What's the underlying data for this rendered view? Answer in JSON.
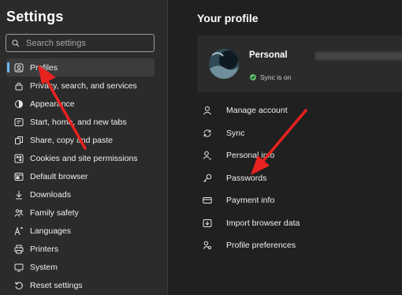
{
  "sidebar": {
    "title": "Settings",
    "search": {
      "placeholder": "Search settings"
    },
    "items": [
      {
        "label": "Profiles",
        "icon": "profile-icon",
        "active": true
      },
      {
        "label": "Privacy, search, and services",
        "icon": "lock-icon"
      },
      {
        "label": "Appearance",
        "icon": "appearance-icon"
      },
      {
        "label": "Start, home, and new tabs",
        "icon": "power-icon"
      },
      {
        "label": "Share, copy and paste",
        "icon": "share-icon"
      },
      {
        "label": "Cookies and site permissions",
        "icon": "cookies-icon"
      },
      {
        "label": "Default browser",
        "icon": "browser-icon"
      },
      {
        "label": "Downloads",
        "icon": "download-icon"
      },
      {
        "label": "Family safety",
        "icon": "family-icon"
      },
      {
        "label": "Languages",
        "icon": "languages-icon"
      },
      {
        "label": "Printers",
        "icon": "printer-icon"
      },
      {
        "label": "System",
        "icon": "system-icon"
      },
      {
        "label": "Reset settings",
        "icon": "reset-icon"
      }
    ]
  },
  "main": {
    "title": "Your profile",
    "profile": {
      "name": "Personal",
      "sync_status": "Sync is on"
    },
    "options": [
      {
        "label": "Manage account",
        "icon": "account-icon"
      },
      {
        "label": "Sync",
        "icon": "sync-icon"
      },
      {
        "label": "Personal info",
        "icon": "personal-info-icon"
      },
      {
        "label": "Passwords",
        "icon": "key-icon"
      },
      {
        "label": "Payment info",
        "icon": "card-icon"
      },
      {
        "label": "Import browser data",
        "icon": "import-icon"
      },
      {
        "label": "Profile preferences",
        "icon": "preferences-icon"
      }
    ]
  },
  "colors": {
    "sidebar_bg": "#2b2b2b",
    "main_bg": "#202020",
    "accent": "#6cb8f6",
    "annotation_arrow": "#e8221f",
    "sync_green": "#5fbf6a"
  }
}
